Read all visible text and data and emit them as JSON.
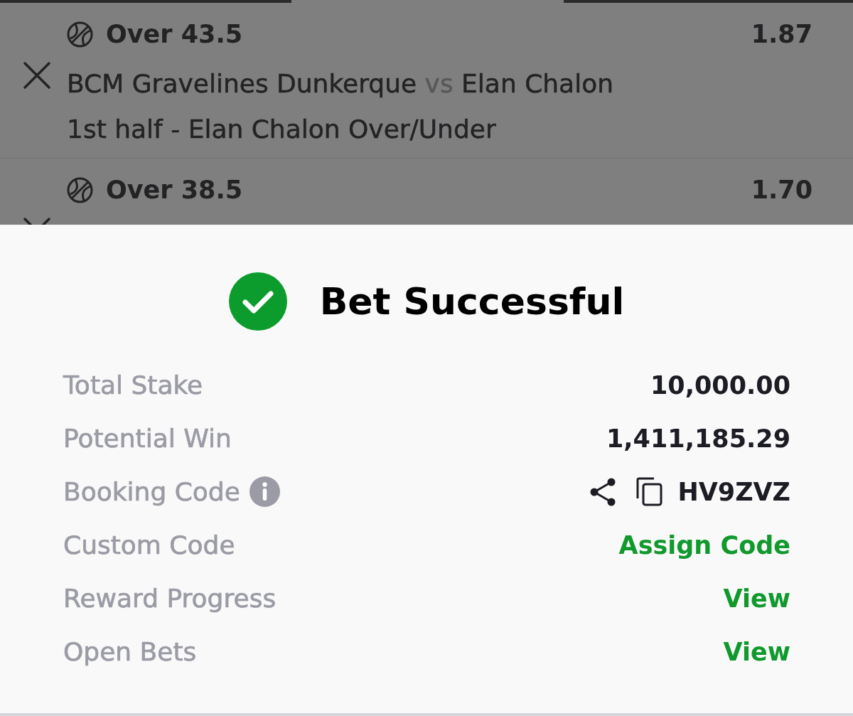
{
  "bet_slip": {
    "selections": [
      {
        "pick": "Over 43.5",
        "odds": "1.87",
        "home_team": "BCM Gravelines Dunkerque",
        "separator": "vs",
        "away_team": "Elan Chalon",
        "market": "1st half - Elan Chalon Over/Under"
      },
      {
        "pick": "Over 38.5",
        "odds": "1.70"
      }
    ]
  },
  "confirmation": {
    "title": "Bet Successful",
    "rows": [
      {
        "kind": "amount",
        "label": "Total Stake",
        "value": "10,000.00"
      },
      {
        "kind": "amount",
        "label": "Potential Win",
        "value": "1,411,185.29"
      },
      {
        "kind": "code",
        "label": "Booking Code",
        "info": true,
        "value": "HV9ZVZ"
      },
      {
        "kind": "link",
        "label": "Custom Code",
        "value": "Assign Code"
      },
      {
        "kind": "link",
        "label": "Reward Progress",
        "value": "View"
      },
      {
        "kind": "link",
        "label": "Open Bets",
        "value": "View"
      }
    ]
  }
}
